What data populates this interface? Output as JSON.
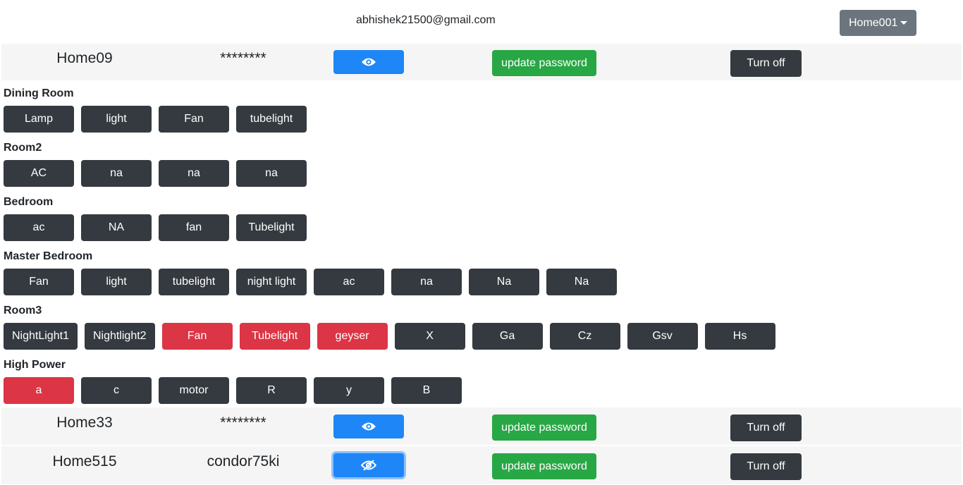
{
  "user": {
    "email": "abhishek21500@gmail.com"
  },
  "home_selector": {
    "label": "Home001"
  },
  "homes": [
    {
      "name": "Home09",
      "password": "********",
      "update_label": "update password",
      "power_label": "Turn off",
      "eye_icon": "eye-icon"
    },
    {
      "name": "Home33",
      "password": "********",
      "update_label": "update password",
      "power_label": "Turn off",
      "eye_icon": "eye-icon"
    },
    {
      "name": "Home515",
      "password": "condor75ki",
      "update_label": "update password",
      "power_label": "Turn off",
      "eye_icon": "eye-slash-icon"
    }
  ],
  "rooms": [
    {
      "name": "Dining Room",
      "devices": [
        {
          "label": "Lamp",
          "on": false
        },
        {
          "label": "light",
          "on": false
        },
        {
          "label": "Fan",
          "on": false
        },
        {
          "label": "tubelight",
          "on": false
        }
      ]
    },
    {
      "name": "Room2",
      "devices": [
        {
          "label": "AC",
          "on": false
        },
        {
          "label": "na",
          "on": false
        },
        {
          "label": "na",
          "on": false
        },
        {
          "label": "na",
          "on": false
        }
      ]
    },
    {
      "name": "Bedroom",
      "devices": [
        {
          "label": "ac",
          "on": false
        },
        {
          "label": "NA",
          "on": false
        },
        {
          "label": "fan",
          "on": false
        },
        {
          "label": "Tubelight",
          "on": false
        }
      ]
    },
    {
      "name": "Master Bedroom",
      "devices": [
        {
          "label": "Fan",
          "on": false
        },
        {
          "label": "light",
          "on": false
        },
        {
          "label": "tubelight",
          "on": false
        },
        {
          "label": "night light",
          "on": false
        },
        {
          "label": "ac",
          "on": false
        },
        {
          "label": "na",
          "on": false
        },
        {
          "label": "Na",
          "on": false
        },
        {
          "label": "Na",
          "on": false
        }
      ]
    },
    {
      "name": "Room3",
      "devices": [
        {
          "label": "NightLight1",
          "on": false
        },
        {
          "label": "Nightlight2",
          "on": false
        },
        {
          "label": "Fan",
          "on": true
        },
        {
          "label": "Tubelight",
          "on": true
        },
        {
          "label": "geyser",
          "on": true
        },
        {
          "label": "X",
          "on": false
        },
        {
          "label": "Ga",
          "on": false
        },
        {
          "label": "Cz",
          "on": false
        },
        {
          "label": "Gsv",
          "on": false
        },
        {
          "label": "Hs",
          "on": false
        }
      ]
    },
    {
      "name": "High Power",
      "devices": [
        {
          "label": "a",
          "on": true
        },
        {
          "label": "c",
          "on": false
        },
        {
          "label": "motor",
          "on": false
        },
        {
          "label": "R",
          "on": false
        },
        {
          "label": "y",
          "on": false
        },
        {
          "label": "B",
          "on": false
        }
      ]
    }
  ],
  "colors": {
    "device_off": "#343a40",
    "device_on": "#dc3545",
    "primary": "#1e86f7",
    "success": "#28a745",
    "secondary": "#6c757d"
  }
}
